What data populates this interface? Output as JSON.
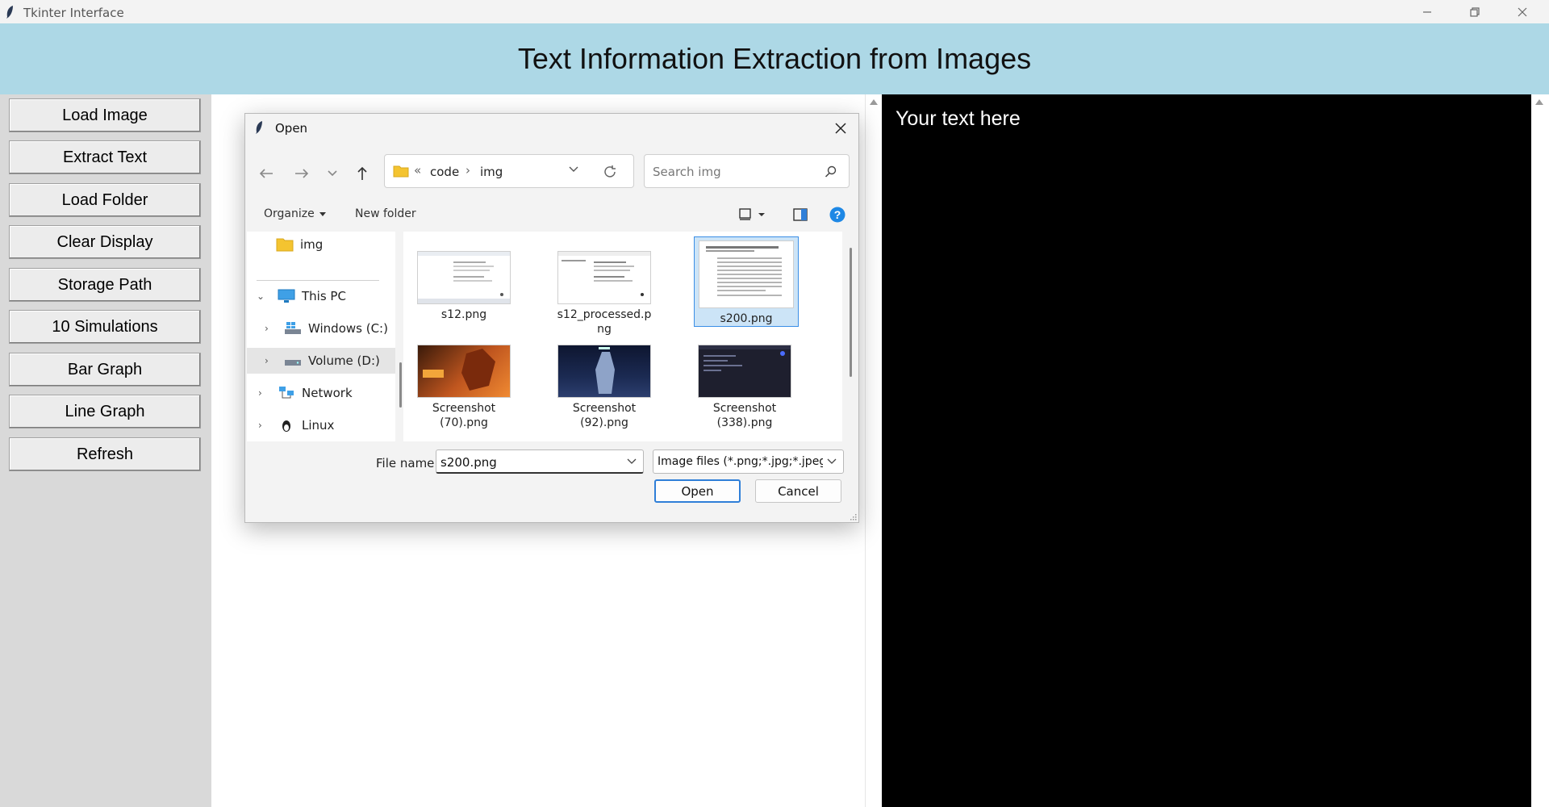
{
  "window": {
    "title": "Tkinter Interface",
    "controls": [
      "minimize",
      "restore",
      "close"
    ]
  },
  "header": {
    "title": "Text Information Extraction from Images"
  },
  "sidebar": {
    "buttons": [
      "Load Image",
      "Extract Text",
      "Load Folder",
      "Clear Display",
      "Storage Path",
      "10 Simulations",
      "Bar Graph",
      "Line Graph",
      "Refresh"
    ]
  },
  "text_panel": {
    "content": "Your text here"
  },
  "dialog": {
    "title": "Open",
    "breadcrumb": {
      "overflow": "«",
      "parts": [
        "code",
        "img"
      ]
    },
    "search_placeholder": "Search img",
    "toolbar": {
      "organize": "Organize",
      "new_folder": "New folder"
    },
    "nav": {
      "pinned": "img",
      "this_pc": "This PC",
      "drives": [
        "Windows (C:)",
        "Volume (D:)"
      ],
      "network": "Network",
      "linux": "Linux",
      "selected": "Volume (D:)"
    },
    "files": [
      {
        "name": "s12.png",
        "thumb": "document"
      },
      {
        "name": "s12_processed.png",
        "thumb": "document"
      },
      {
        "name": "s200.png",
        "thumb": "paper",
        "selected": true
      },
      {
        "name": "Screenshot (70).png",
        "thumb": "game-orange"
      },
      {
        "name": "Screenshot (92).png",
        "thumb": "game-blue"
      },
      {
        "name": "Screenshot (338).png",
        "thumb": "code-dark"
      }
    ],
    "file_name_label": "File name:",
    "file_name_value": "s200.png",
    "file_type": "Image files (*.png;*.jpg;*.jpeg;*",
    "open_button": "Open",
    "cancel_button": "Cancel"
  },
  "colors": {
    "header_bg": "#add8e6",
    "sidebar_bg": "#d9d9d9",
    "text_panel_bg": "#000000",
    "accent": "#2f7fd8"
  }
}
